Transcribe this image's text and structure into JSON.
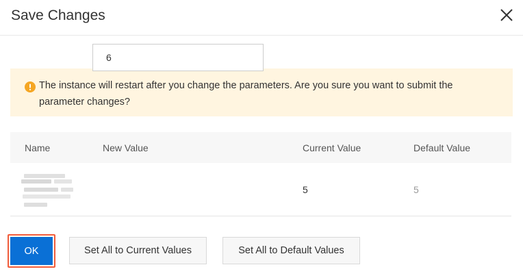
{
  "dialog": {
    "title": "Save Changes",
    "close_icon": "close-icon"
  },
  "alert": {
    "icon": "warning-icon",
    "icon_color": "#f5a623",
    "background": "#fff5e0",
    "message": "The instance will restart after you change the parameters. Are you sure you want to submit the parameter changes?"
  },
  "table": {
    "columns": {
      "name": "Name",
      "new_value": "New Value",
      "current_value": "Current Value",
      "default_value": "Default Value"
    },
    "rows": [
      {
        "name": "",
        "new_value": "6",
        "current_value": "5",
        "default_value": "5"
      }
    ]
  },
  "footer": {
    "ok_label": "OK",
    "set_current_label": "Set All to Current Values",
    "set_default_label": "Set All to Default Values",
    "primary_color": "#0a70d6",
    "highlight_color": "#f25c3a"
  }
}
